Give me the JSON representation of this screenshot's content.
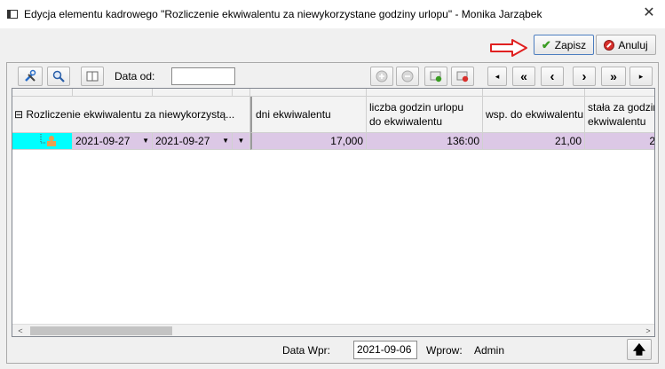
{
  "window": {
    "title": "Edycja elementu kadrowego \"Rozliczenie ekwiwalentu za niewykorzystane godziny urlopu\" - Monika Jarząbek",
    "close_symbol": "✕"
  },
  "actions": {
    "save_label": "Zapisz",
    "cancel_label": "Anuluj"
  },
  "toolbar": {
    "date_from_label": "Data od:",
    "date_from_value": "",
    "nav_first": "«",
    "nav_prev": "‹",
    "nav_next": "›",
    "nav_last": "»",
    "nav_start": "◂",
    "nav_end": "▸"
  },
  "grid": {
    "group_header": "⊟ Rozliczenie ekwiwalentu za niewykorzystą...",
    "columns": {
      "dni": "dni ekwiwalentu",
      "liczba_line1": "liczba godzin urlopu",
      "liczba_line2": "do ekwiwalentu",
      "wsp": "wsp. do ekwiwalentu",
      "stala_line1": "stała za godzin",
      "stala_line2": "ekwiwalentu"
    },
    "row": {
      "date_from": "2021-09-27",
      "date_to": "2021-09-27",
      "dni": "17,000",
      "liczba": "136:00",
      "wsp": "21,00",
      "stala": "2"
    }
  },
  "footer": {
    "data_wpr_label": "Data Wpr:",
    "data_wpr_value": "2021-09-06",
    "wprow_label": "Wprow:",
    "wprow_value": "Admin",
    "up_symbol": "🡅"
  },
  "colors": {
    "row_selected": "#dcc8e6",
    "row_indicator": "#00ffff",
    "arrow": "#e02020",
    "save_check": "#3a9c22",
    "cancel_icon": "#d8302c"
  }
}
